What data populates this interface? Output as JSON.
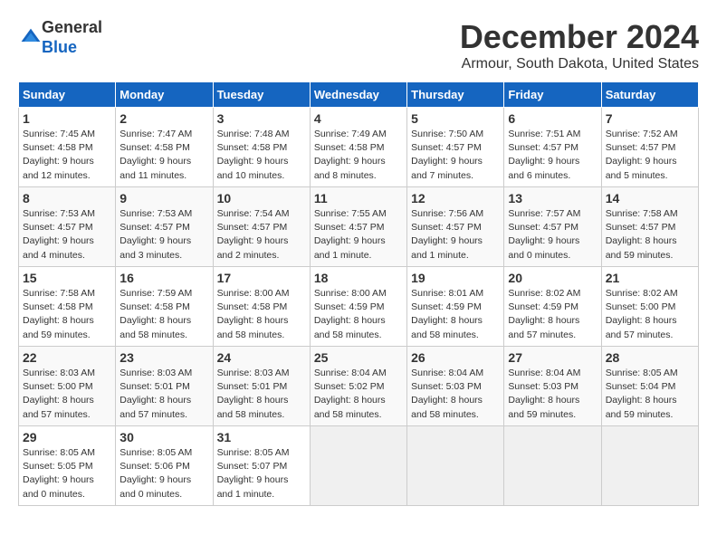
{
  "header": {
    "logo_general": "General",
    "logo_blue": "Blue",
    "month_title": "December 2024",
    "location": "Armour, South Dakota, United States"
  },
  "calendar": {
    "days_of_week": [
      "Sunday",
      "Monday",
      "Tuesday",
      "Wednesday",
      "Thursday",
      "Friday",
      "Saturday"
    ],
    "weeks": [
      [
        null,
        null,
        null,
        null,
        null,
        null,
        null
      ]
    ],
    "cells": [
      {
        "day": null,
        "info": null
      },
      {
        "day": null,
        "info": null
      },
      {
        "day": null,
        "info": null
      },
      {
        "day": null,
        "info": null
      },
      {
        "day": null,
        "info": null
      },
      {
        "day": null,
        "info": null
      },
      {
        "day": null,
        "info": null
      },
      {
        "day": "1",
        "info": "Sunrise: 7:45 AM\nSunset: 4:58 PM\nDaylight: 9 hours\nand 12 minutes."
      },
      {
        "day": "2",
        "info": "Sunrise: 7:47 AM\nSunset: 4:58 PM\nDaylight: 9 hours\nand 11 minutes."
      },
      {
        "day": "3",
        "info": "Sunrise: 7:48 AM\nSunset: 4:58 PM\nDaylight: 9 hours\nand 10 minutes."
      },
      {
        "day": "4",
        "info": "Sunrise: 7:49 AM\nSunset: 4:58 PM\nDaylight: 9 hours\nand 8 minutes."
      },
      {
        "day": "5",
        "info": "Sunrise: 7:50 AM\nSunset: 4:57 PM\nDaylight: 9 hours\nand 7 minutes."
      },
      {
        "day": "6",
        "info": "Sunrise: 7:51 AM\nSunset: 4:57 PM\nDaylight: 9 hours\nand 6 minutes."
      },
      {
        "day": "7",
        "info": "Sunrise: 7:52 AM\nSunset: 4:57 PM\nDaylight: 9 hours\nand 5 minutes."
      },
      {
        "day": "8",
        "info": "Sunrise: 7:53 AM\nSunset: 4:57 PM\nDaylight: 9 hours\nand 4 minutes."
      },
      {
        "day": "9",
        "info": "Sunrise: 7:53 AM\nSunset: 4:57 PM\nDaylight: 9 hours\nand 3 minutes."
      },
      {
        "day": "10",
        "info": "Sunrise: 7:54 AM\nSunset: 4:57 PM\nDaylight: 9 hours\nand 2 minutes."
      },
      {
        "day": "11",
        "info": "Sunrise: 7:55 AM\nSunset: 4:57 PM\nDaylight: 9 hours\nand 1 minute."
      },
      {
        "day": "12",
        "info": "Sunrise: 7:56 AM\nSunset: 4:57 PM\nDaylight: 9 hours\nand 1 minute."
      },
      {
        "day": "13",
        "info": "Sunrise: 7:57 AM\nSunset: 4:57 PM\nDaylight: 9 hours\nand 0 minutes."
      },
      {
        "day": "14",
        "info": "Sunrise: 7:58 AM\nSunset: 4:57 PM\nDaylight: 8 hours\nand 59 minutes."
      },
      {
        "day": "15",
        "info": "Sunrise: 7:58 AM\nSunset: 4:58 PM\nDaylight: 8 hours\nand 59 minutes."
      },
      {
        "day": "16",
        "info": "Sunrise: 7:59 AM\nSunset: 4:58 PM\nDaylight: 8 hours\nand 58 minutes."
      },
      {
        "day": "17",
        "info": "Sunrise: 8:00 AM\nSunset: 4:58 PM\nDaylight: 8 hours\nand 58 minutes."
      },
      {
        "day": "18",
        "info": "Sunrise: 8:00 AM\nSunset: 4:59 PM\nDaylight: 8 hours\nand 58 minutes."
      },
      {
        "day": "19",
        "info": "Sunrise: 8:01 AM\nSunset: 4:59 PM\nDaylight: 8 hours\nand 58 minutes."
      },
      {
        "day": "20",
        "info": "Sunrise: 8:02 AM\nSunset: 4:59 PM\nDaylight: 8 hours\nand 57 minutes."
      },
      {
        "day": "21",
        "info": "Sunrise: 8:02 AM\nSunset: 5:00 PM\nDaylight: 8 hours\nand 57 minutes."
      },
      {
        "day": "22",
        "info": "Sunrise: 8:03 AM\nSunset: 5:00 PM\nDaylight: 8 hours\nand 57 minutes."
      },
      {
        "day": "23",
        "info": "Sunrise: 8:03 AM\nSunset: 5:01 PM\nDaylight: 8 hours\nand 57 minutes."
      },
      {
        "day": "24",
        "info": "Sunrise: 8:03 AM\nSunset: 5:01 PM\nDaylight: 8 hours\nand 58 minutes."
      },
      {
        "day": "25",
        "info": "Sunrise: 8:04 AM\nSunset: 5:02 PM\nDaylight: 8 hours\nand 58 minutes."
      },
      {
        "day": "26",
        "info": "Sunrise: 8:04 AM\nSunset: 5:03 PM\nDaylight: 8 hours\nand 58 minutes."
      },
      {
        "day": "27",
        "info": "Sunrise: 8:04 AM\nSunset: 5:03 PM\nDaylight: 8 hours\nand 59 minutes."
      },
      {
        "day": "28",
        "info": "Sunrise: 8:05 AM\nSunset: 5:04 PM\nDaylight: 8 hours\nand 59 minutes."
      },
      {
        "day": "29",
        "info": "Sunrise: 8:05 AM\nSunset: 5:05 PM\nDaylight: 9 hours\nand 0 minutes."
      },
      {
        "day": "30",
        "info": "Sunrise: 8:05 AM\nSunset: 5:06 PM\nDaylight: 9 hours\nand 0 minutes."
      },
      {
        "day": "31",
        "info": "Sunrise: 8:05 AM\nSunset: 5:07 PM\nDaylight: 9 hours\nand 1 minute."
      },
      {
        "day": null,
        "info": null
      },
      {
        "day": null,
        "info": null
      },
      {
        "day": null,
        "info": null
      },
      {
        "day": null,
        "info": null
      }
    ]
  }
}
